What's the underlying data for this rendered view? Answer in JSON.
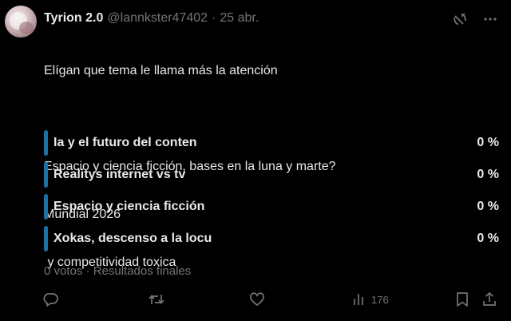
{
  "user": {
    "name": "Tyrion 2.0",
    "handle": "@lannkster47402",
    "separator": "·",
    "date": "25 abr."
  },
  "text_lines": [
    "Elígan que tema le llama más la atención",
    "",
    "Espacio y ciencia ficción, bases en la luna y marte?",
    "Mundial 2026",
    " y competitividad toxica"
  ],
  "poll": {
    "bar_color": "#1d6fa5",
    "options": [
      {
        "label": "Ia y el futuro del conten",
        "percent": "0 %"
      },
      {
        "label": "Realitys internet vs tv",
        "percent": "0 %"
      },
      {
        "label": "Espacio y ciencia ficción",
        "percent": "0 %"
      },
      {
        "label": "Xokas, descenso a la locu",
        "percent": "0 %"
      }
    ],
    "meta": "0 votos · Resultados finales"
  },
  "actions": {
    "views": "176"
  },
  "icons": [
    "grok-icon",
    "more-icon",
    "reply-icon",
    "retweet-icon",
    "like-icon",
    "views-icon",
    "bookmark-icon",
    "share-icon"
  ]
}
